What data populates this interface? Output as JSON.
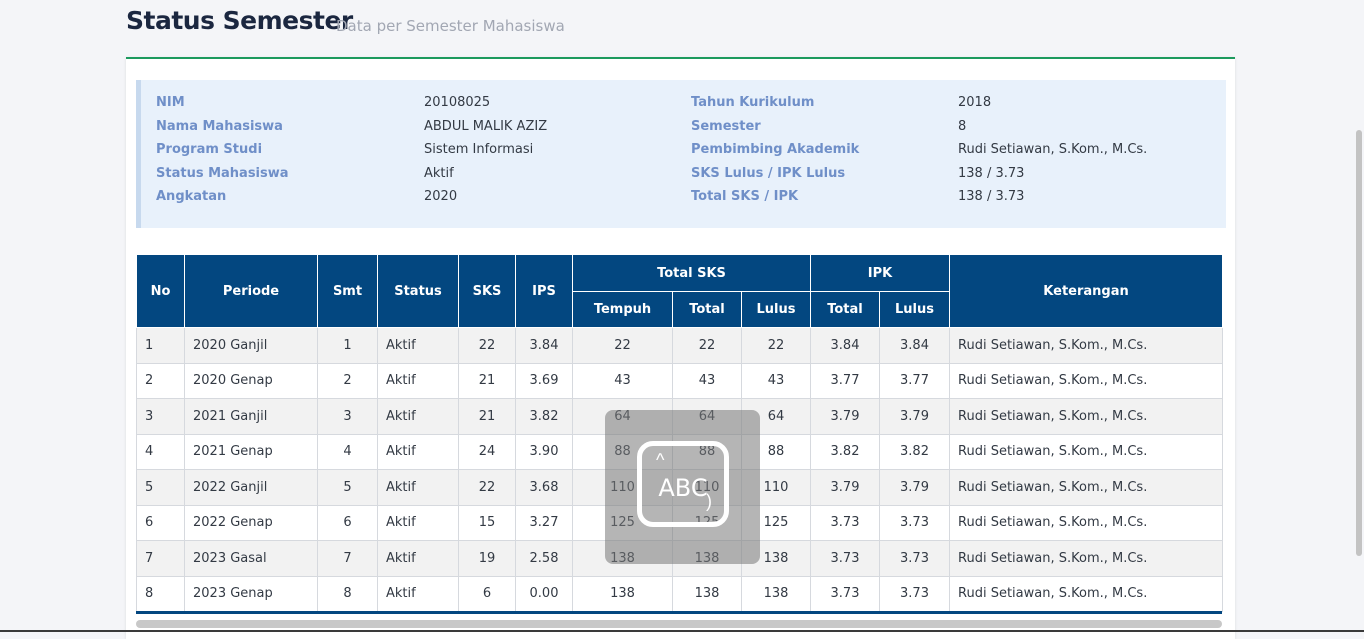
{
  "header": {
    "title": "Status Semester",
    "subtitle": "Data per Semester Mahasiswa"
  },
  "info": {
    "left": [
      {
        "label": "NIM",
        "value": "20108025"
      },
      {
        "label": "Nama Mahasiswa",
        "value": "ABDUL MALIK AZIZ"
      },
      {
        "label": "Program Studi",
        "value": "Sistem Informasi"
      },
      {
        "label": "Status Mahasiswa",
        "value": "Aktif"
      },
      {
        "label": "Angkatan",
        "value": "2020"
      }
    ],
    "right": [
      {
        "label": "Tahun Kurikulum",
        "value": "2018"
      },
      {
        "label": "Semester",
        "value": "8"
      },
      {
        "label": "Pembimbing Akademik",
        "value": "Rudi Setiawan, S.Kom., M.Cs."
      },
      {
        "label": "SKS Lulus / IPK Lulus",
        "value": "138 / 3.73"
      },
      {
        "label": "Total SKS / IPK",
        "value": "138 / 3.73"
      }
    ]
  },
  "table": {
    "headers": {
      "no": "No",
      "periode": "Periode",
      "smt": "Smt",
      "status": "Status",
      "sks": "SKS",
      "ips": "IPS",
      "total_sks": "Total SKS",
      "ipk": "IPK",
      "keterangan": "Keterangan",
      "tempuh": "Tempuh",
      "total": "Total",
      "lulus": "Lulus",
      "ipk_total": "Total",
      "ipk_lulus": "Lulus"
    },
    "rows": [
      [
        "1",
        "2020 Ganjil",
        "1",
        "Aktif",
        "22",
        "3.84",
        "22",
        "22",
        "22",
        "3.84",
        "3.84",
        "Rudi Setiawan, S.Kom., M.Cs."
      ],
      [
        "2",
        "2020 Genap",
        "2",
        "Aktif",
        "21",
        "3.69",
        "43",
        "43",
        "43",
        "3.77",
        "3.77",
        "Rudi Setiawan, S.Kom., M.Cs."
      ],
      [
        "3",
        "2021 Ganjil",
        "3",
        "Aktif",
        "21",
        "3.82",
        "64",
        "64",
        "64",
        "3.79",
        "3.79",
        "Rudi Setiawan, S.Kom., M.Cs."
      ],
      [
        "4",
        "2021 Genap",
        "4",
        "Aktif",
        "24",
        "3.90",
        "88",
        "88",
        "88",
        "3.82",
        "3.82",
        "Rudi Setiawan, S.Kom., M.Cs."
      ],
      [
        "5",
        "2022 Ganjil",
        "5",
        "Aktif",
        "22",
        "3.68",
        "110",
        "110",
        "110",
        "3.79",
        "3.79",
        "Rudi Setiawan, S.Kom., M.Cs."
      ],
      [
        "6",
        "2022 Genap",
        "6",
        "Aktif",
        "15",
        "3.27",
        "125",
        "125",
        "125",
        "3.73",
        "3.73",
        "Rudi Setiawan, S.Kom., M.Cs."
      ],
      [
        "7",
        "2023 Gasal",
        "7",
        "Aktif",
        "19",
        "2.58",
        "138",
        "138",
        "138",
        "3.73",
        "3.73",
        "Rudi Setiawan, S.Kom., M.Cs."
      ],
      [
        "8",
        "2023 Genap",
        "8",
        "Aktif",
        "6",
        "0.00",
        "138",
        "138",
        "138",
        "3.73",
        "3.73",
        "Rudi Setiawan, S.Kom., M.Cs."
      ]
    ]
  },
  "overlay": {
    "text": "ABC",
    "icon": "text-recognition-icon"
  },
  "colors": {
    "accent": "#1c9a5e",
    "header_bg": "#034780",
    "label": "#6f8fc8",
    "info_bg": "#e8f1fb"
  }
}
